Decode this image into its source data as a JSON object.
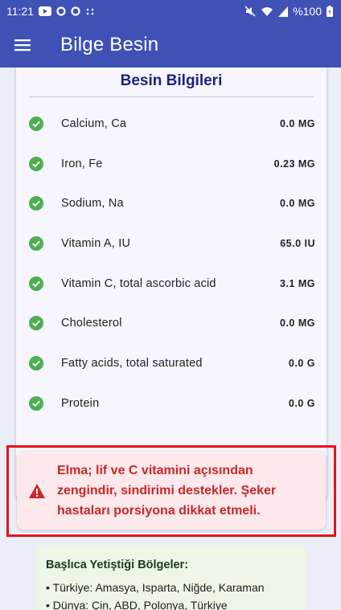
{
  "status_bar": {
    "time": "11:21",
    "battery": "%100",
    "icons": [
      "youtube-icon",
      "circle-icon",
      "circle-icon",
      "dots-icon",
      "mute-icon",
      "wifi-icon",
      "signal-icon",
      "battery-icon"
    ]
  },
  "app_bar": {
    "title": "Bilge Besin",
    "menu_icon": "hamburger-menu-icon"
  },
  "nutrition_card": {
    "title": "Besin Bilgileri",
    "items": [
      {
        "name": "Calcium, Ca",
        "value": "0.0 MG"
      },
      {
        "name": "Iron, Fe",
        "value": "0.23 MG"
      },
      {
        "name": "Sodium, Na",
        "value": "0.0 MG"
      },
      {
        "name": "Vitamin A, IU",
        "value": "65.0 IU"
      },
      {
        "name": "Vitamin C, total ascorbic acid",
        "value": "3.1 MG"
      },
      {
        "name": "Cholesterol",
        "value": "0.0 MG"
      },
      {
        "name": "Fatty acids, total saturated",
        "value": "0.0 G"
      },
      {
        "name": "Protein",
        "value": "0.0 G"
      }
    ]
  },
  "warning": {
    "icon": "warning-triangle-icon",
    "text_lines": [
      "Elma; lif ve C vitamini açısından",
      "zengindir, sindirimi destekler. Şeker",
      "hastaları porsiyona dikkat etmeli."
    ]
  },
  "regions": {
    "title": "Başlıca Yetiştiği Bölgeler:",
    "lines": [
      "• Türkiye: Amasya, Isparta, Niğde, Karaman",
      "• Dünya: Çin, ABD, Polonya, Türkiye"
    ]
  },
  "colors": {
    "primary": "#3f51b5",
    "card_title": "#1a237e",
    "check": "#4caf50",
    "warning_text": "#c62828",
    "warning_bg": "#fde8ec",
    "highlight_border": "#e8121c",
    "regions_bg": "#eef6e7"
  }
}
